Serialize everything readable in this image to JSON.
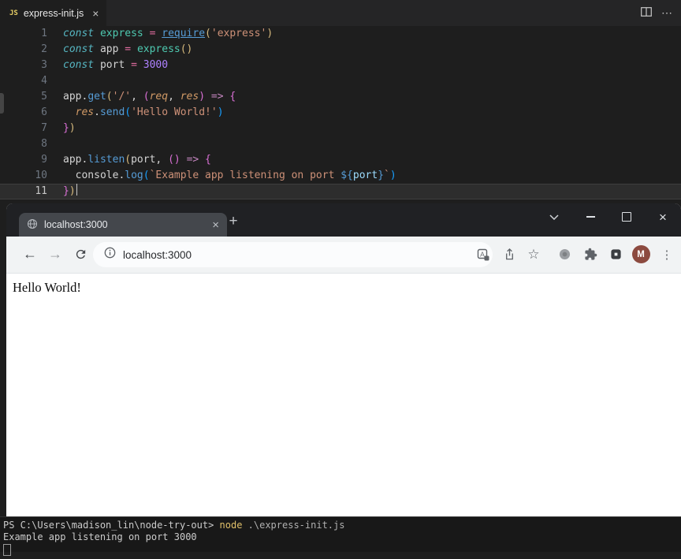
{
  "palette": {
    "kw": "#56B6C2",
    "green": "#4EC9B0",
    "plain": "#D4D4D4",
    "op": "#E06C9F",
    "op2": "#C586C0",
    "fn": "#569CD6",
    "fnu": "#569CD6",
    "str": "#CE9178",
    "b1": "#D7BA7D",
    "b2": "#DA70D6",
    "b3": "#179FFF",
    "param": "#D19A66",
    "num": "#AE81FF",
    "tmpl": "#569CD6",
    "tvar": "#9CDCFE"
  },
  "vscode": {
    "tab": {
      "label": "express-init.js",
      "file_badge": "JS",
      "close_glyph": "×"
    },
    "tabbar_actions": {
      "more_glyph": "⋯"
    },
    "lines": [
      {
        "n": 1,
        "tokens": [
          [
            "const ",
            "kw"
          ],
          [
            "express ",
            "green"
          ],
          [
            "= ",
            "op"
          ],
          [
            "require",
            "fnu"
          ],
          [
            "(",
            "b1"
          ],
          [
            "'express'",
            "str"
          ],
          [
            ")",
            "b1"
          ]
        ]
      },
      {
        "n": 2,
        "tokens": [
          [
            "const ",
            "kw"
          ],
          [
            "app ",
            "plain"
          ],
          [
            "= ",
            "op"
          ],
          [
            "express",
            "green"
          ],
          [
            "()",
            "b1"
          ]
        ]
      },
      {
        "n": 3,
        "tokens": [
          [
            "const ",
            "kw"
          ],
          [
            "port ",
            "plain"
          ],
          [
            "= ",
            "op"
          ],
          [
            "3000",
            "num"
          ]
        ]
      },
      {
        "n": 4,
        "tokens": []
      },
      {
        "n": 5,
        "tokens": [
          [
            "app",
            "plain"
          ],
          [
            ".",
            "plain"
          ],
          [
            "get",
            "fn"
          ],
          [
            "(",
            "b1"
          ],
          [
            "'/'",
            "str"
          ],
          [
            ", ",
            "plain"
          ],
          [
            "(",
            "b2"
          ],
          [
            "req",
            "param"
          ],
          [
            ", ",
            "plain"
          ],
          [
            "res",
            "param"
          ],
          [
            ")",
            "b2"
          ],
          [
            " ",
            "plain"
          ],
          [
            "=>",
            "op2"
          ],
          [
            " ",
            "plain"
          ],
          [
            "{",
            "b2"
          ]
        ]
      },
      {
        "n": 6,
        "tokens": [
          [
            "  ",
            "plain"
          ],
          [
            "res",
            "param"
          ],
          [
            ".",
            "plain"
          ],
          [
            "send",
            "fn"
          ],
          [
            "(",
            "b3"
          ],
          [
            "'Hello World!'",
            "str"
          ],
          [
            ")",
            "b3"
          ]
        ]
      },
      {
        "n": 7,
        "tokens": [
          [
            "}",
            "b2"
          ],
          [
            ")",
            "b1"
          ]
        ]
      },
      {
        "n": 8,
        "tokens": []
      },
      {
        "n": 9,
        "tokens": [
          [
            "app",
            "plain"
          ],
          [
            ".",
            "plain"
          ],
          [
            "listen",
            "fn"
          ],
          [
            "(",
            "b1"
          ],
          [
            "port",
            "plain"
          ],
          [
            ", ",
            "plain"
          ],
          [
            "()",
            "b2"
          ],
          [
            " ",
            "plain"
          ],
          [
            "=>",
            "op2"
          ],
          [
            " ",
            "plain"
          ],
          [
            "{",
            "b2"
          ]
        ]
      },
      {
        "n": 10,
        "tokens": [
          [
            "  ",
            "plain"
          ],
          [
            "console",
            "plain"
          ],
          [
            ".",
            "plain"
          ],
          [
            "log",
            "fn"
          ],
          [
            "(",
            "b3"
          ],
          [
            "`Example app listening on port ",
            "str"
          ],
          [
            "${",
            "tmpl"
          ],
          [
            "port",
            "tvar"
          ],
          [
            "}",
            "tmpl"
          ],
          [
            "`",
            "str"
          ],
          [
            ")",
            "b3"
          ]
        ]
      },
      {
        "n": 11,
        "active": true,
        "tokens": [
          [
            "}",
            "b2"
          ],
          [
            ")",
            "b1"
          ]
        ]
      }
    ]
  },
  "chrome": {
    "tab": {
      "title": "localhost:3000",
      "close_glyph": "×"
    },
    "new_tab_glyph": "+",
    "window": {
      "close_glyph": "×"
    },
    "toolbar": {
      "back_glyph": "←",
      "forward_glyph": "→",
      "url": "localhost:3000",
      "star_glyph": "☆",
      "kebab_glyph": "⋮",
      "avatar_letter": "M",
      "avatar_color": "#8c4a3f"
    },
    "page": {
      "text": "Hello World!"
    }
  },
  "terminal": {
    "palette": {
      "plain": "#cccccc",
      "cmd": "#e0c06a",
      "arg": "#b0b0b0"
    },
    "lines": [
      {
        "tokens": [
          [
            "PS C:\\Users\\madison_lin\\node-try-out>",
            "plain"
          ],
          [
            " node",
            "cmd"
          ],
          [
            " .\\express-init.js",
            "arg"
          ]
        ]
      },
      {
        "tokens": [
          [
            "Example app listening on port 3000",
            "plain"
          ]
        ]
      }
    ]
  }
}
